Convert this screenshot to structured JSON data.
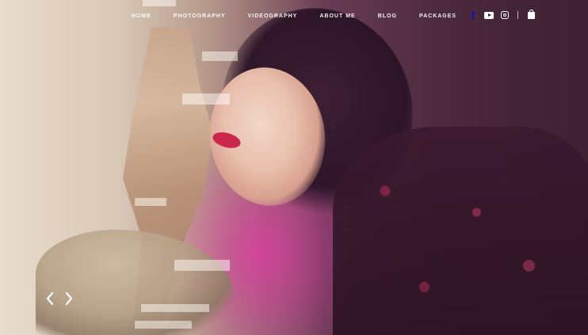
{
  "nav": {
    "items": [
      {
        "label": "HOME"
      },
      {
        "label": "PHOTOGRAPHY"
      },
      {
        "label": "VIDEOGRAPHY"
      },
      {
        "label": "ABOUT ME"
      },
      {
        "label": "BLOG"
      },
      {
        "label": "PACKAGES"
      }
    ]
  },
  "social": {
    "icons": [
      "facebook-icon",
      "youtube-icon",
      "instagram-icon",
      "shopping-bag-icon"
    ],
    "facebook_glyph": "f"
  },
  "slider": {
    "prev_icon": "chevron-left-icon",
    "next_icon": "chevron-right-icon"
  },
  "colors": {
    "accent_pink": "#dc3ca0",
    "lip_red": "#c91d46",
    "nav_text": "#ffffff"
  }
}
